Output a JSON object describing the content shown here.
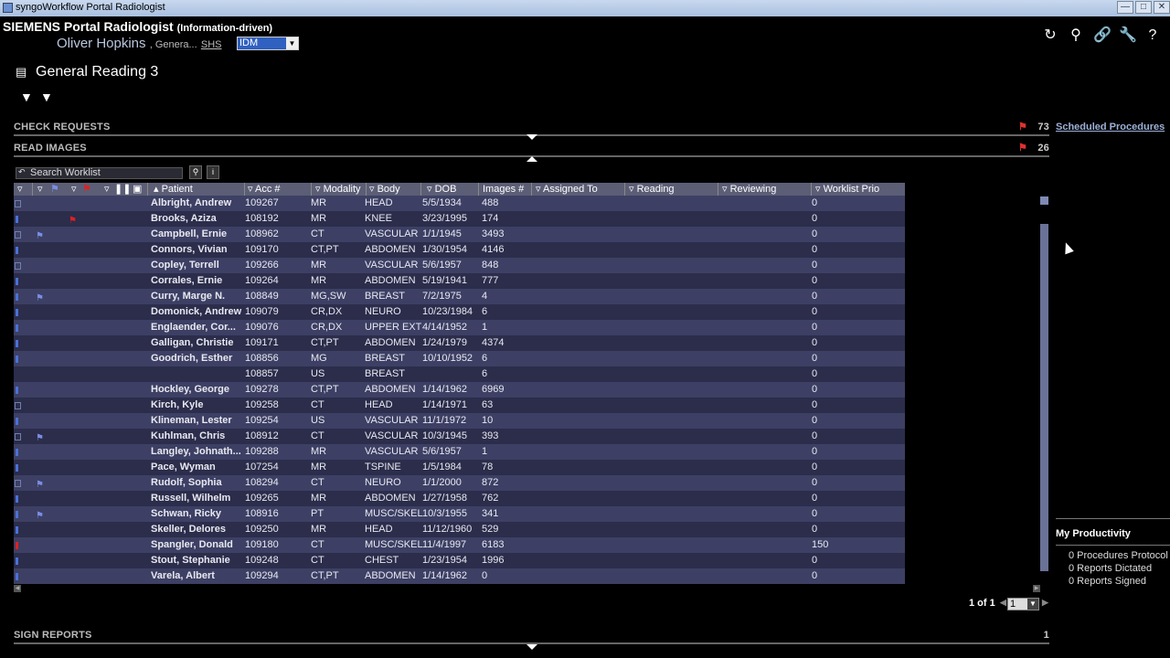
{
  "window": {
    "title": "syngoWorkflow Portal Radiologist",
    "controls": [
      "minimize",
      "maximize",
      "close"
    ]
  },
  "header": {
    "brand": "SIEMENS",
    "portal": "Portal Radiologist",
    "mode": "(Information-driven)",
    "user_name": "Oliver Hopkins",
    "user_role": ", Genera...",
    "site": "SHS",
    "context_select": "IDM"
  },
  "toolbar_icons": [
    "refresh-icon",
    "search-person-icon",
    "link-icon",
    "wrench-icon",
    "help-icon"
  ],
  "worklist_title": "General Reading 3",
  "sections": {
    "check_requests": {
      "label": "CHECK REQUESTS",
      "count": "73"
    },
    "read_images": {
      "label": "READ IMAGES",
      "count": "26"
    },
    "sign_reports": {
      "label": "SIGN REPORTS",
      "count": "1"
    }
  },
  "side_panel": {
    "scheduled_procedures": "Scheduled Procedures",
    "productivity_title": "My Productivity",
    "productivity_items": [
      "0 Procedures Protocol",
      "0 Reports Dictated",
      "0 Reports Signed"
    ]
  },
  "search": {
    "placeholder": "Search Worklist"
  },
  "columns": [
    "Patient",
    "Acc #",
    "Modality",
    "Body",
    "DOB",
    "Images #",
    "Assigned To",
    "Reading",
    "Reviewing",
    "Worklist Prio"
  ],
  "rows": [
    {
      "patient": "Albright, Andrew",
      "acc": "109267",
      "mod": "MR",
      "body": "HEAD",
      "dob": "5/5/1934",
      "images": "488",
      "prio": "0",
      "status": "box",
      "flag": false,
      "redflag": false
    },
    {
      "patient": "Brooks, Aziza",
      "acc": "108192",
      "mod": "MR",
      "body": "KNEE",
      "dob": "3/23/1995",
      "images": "174",
      "prio": "0",
      "status": "bar",
      "flag": false,
      "redflag": true
    },
    {
      "patient": "Campbell, Ernie",
      "acc": "108962",
      "mod": "CT",
      "body": "VASCULAR",
      "dob": "1/1/1945",
      "images": "3493",
      "prio": "0",
      "status": "box",
      "flag": true,
      "redflag": false
    },
    {
      "patient": "Connors, Vivian",
      "acc": "109170",
      "mod": "CT,PT",
      "body": "ABDOMEN",
      "dob": "1/30/1954",
      "images": "4146",
      "prio": "0",
      "status": "bar",
      "flag": false,
      "redflag": false
    },
    {
      "patient": "Copley, Terrell",
      "acc": "109266",
      "mod": "MR",
      "body": "VASCULAR",
      "dob": "5/6/1957",
      "images": "848",
      "prio": "0",
      "status": "box",
      "flag": false,
      "redflag": false
    },
    {
      "patient": "Corrales, Ernie",
      "acc": "109264",
      "mod": "MR",
      "body": "ABDOMEN",
      "dob": "5/19/1941",
      "images": "777",
      "prio": "0",
      "status": "bar",
      "flag": false,
      "redflag": false
    },
    {
      "patient": "Curry, Marge N.",
      "acc": "108849",
      "mod": "MG,SW",
      "body": "BREAST",
      "dob": "7/2/1975",
      "images": "4",
      "prio": "0",
      "status": "bar",
      "flag": true,
      "redflag": false
    },
    {
      "patient": "Domonick, Andrew",
      "acc": "109079",
      "mod": "CR,DX",
      "body": "NEURO",
      "dob": "10/23/1984",
      "images": "6",
      "prio": "0",
      "status": "bar",
      "flag": false,
      "redflag": false
    },
    {
      "patient": "Englaender, Cor...",
      "acc": "109076",
      "mod": "CR,DX",
      "body": "UPPER EXT",
      "dob": "4/14/1952",
      "images": "1",
      "prio": "0",
      "status": "bar",
      "flag": false,
      "redflag": false
    },
    {
      "patient": "Galligan, Christie",
      "acc": "109171",
      "mod": "CT,PT",
      "body": "ABDOMEN",
      "dob": "1/24/1979",
      "images": "4374",
      "prio": "0",
      "status": "bar",
      "flag": false,
      "redflag": false
    },
    {
      "patient": "Goodrich, Esther",
      "acc": "108856",
      "mod": "MG",
      "body": "BREAST",
      "dob": "10/10/1952",
      "images": "6",
      "prio": "0",
      "status": "bar",
      "flag": false,
      "redflag": false
    },
    {
      "patient": "",
      "acc": "108857",
      "mod": "US",
      "body": "BREAST",
      "dob": "",
      "images": "6",
      "prio": "0",
      "status": "none",
      "flag": false,
      "redflag": false
    },
    {
      "patient": "Hockley, George",
      "acc": "109278",
      "mod": "CT,PT",
      "body": "ABDOMEN",
      "dob": "1/14/1962",
      "images": "6969",
      "prio": "0",
      "status": "bar",
      "flag": false,
      "redflag": false
    },
    {
      "patient": "Kirch, Kyle",
      "acc": "109258",
      "mod": "CT",
      "body": "HEAD",
      "dob": "1/14/1971",
      "images": "63",
      "prio": "0",
      "status": "box",
      "flag": false,
      "redflag": false
    },
    {
      "patient": "Klineman, Lester",
      "acc": "109254",
      "mod": "US",
      "body": "VASCULAR",
      "dob": "11/1/1972",
      "images": "10",
      "prio": "0",
      "status": "bar",
      "flag": false,
      "redflag": false
    },
    {
      "patient": "Kuhlman, Chris",
      "acc": "108912",
      "mod": "CT",
      "body": "VASCULAR",
      "dob": "10/3/1945",
      "images": "393",
      "prio": "0",
      "status": "box",
      "flag": true,
      "redflag": false
    },
    {
      "patient": "Langley, Johnath...",
      "acc": "109288",
      "mod": "MR",
      "body": "VASCULAR",
      "dob": "5/6/1957",
      "images": "1",
      "prio": "0",
      "status": "bar",
      "flag": false,
      "redflag": false
    },
    {
      "patient": "Pace, Wyman",
      "acc": "107254",
      "mod": "MR",
      "body": "TSPINE",
      "dob": "1/5/1984",
      "images": "78",
      "prio": "0",
      "status": "bar",
      "flag": false,
      "redflag": false
    },
    {
      "patient": "Rudolf, Sophia",
      "acc": "108294",
      "mod": "CT",
      "body": "NEURO",
      "dob": "1/1/2000",
      "images": "872",
      "prio": "0",
      "status": "box",
      "flag": true,
      "redflag": false
    },
    {
      "patient": "Russell, Wilhelm",
      "acc": "109265",
      "mod": "MR",
      "body": "ABDOMEN",
      "dob": "1/27/1958",
      "images": "762",
      "prio": "0",
      "status": "bar",
      "flag": false,
      "redflag": false
    },
    {
      "patient": "Schwan, Ricky",
      "acc": "108916",
      "mod": "PT",
      "body": "MUSC/SKEL",
      "dob": "10/3/1955",
      "images": "341",
      "prio": "0",
      "status": "bar",
      "flag": true,
      "redflag": false
    },
    {
      "patient": "Skeller, Delores",
      "acc": "109250",
      "mod": "MR",
      "body": "HEAD",
      "dob": "11/12/1960",
      "images": "529",
      "prio": "0",
      "status": "bar",
      "flag": false,
      "redflag": false
    },
    {
      "patient": "Spangler, Donald",
      "acc": "109180",
      "mod": "CT",
      "body": "MUSC/SKEL",
      "dob": "11/4/1997",
      "images": "6183",
      "prio": "150",
      "status": "red",
      "flag": false,
      "redflag": false
    },
    {
      "patient": "Stout, Stephanie",
      "acc": "109248",
      "mod": "CT",
      "body": "CHEST",
      "dob": "1/23/1954",
      "images": "1996",
      "prio": "0",
      "status": "bar",
      "flag": false,
      "redflag": false
    },
    {
      "patient": "Varela, Albert",
      "acc": "109294",
      "mod": "CT,PT",
      "body": "ABDOMEN",
      "dob": "1/14/1962",
      "images": "0",
      "prio": "0",
      "status": "bar",
      "flag": false,
      "redflag": false
    }
  ],
  "pager": {
    "text": "1 of 1",
    "page": "1"
  },
  "colors": {
    "row_dark": "#2b2d4b",
    "row_light": "#3d4064",
    "header_bg": "#5c5e76",
    "accent_blue": "#4b71d8",
    "alert_red": "#e02020"
  }
}
